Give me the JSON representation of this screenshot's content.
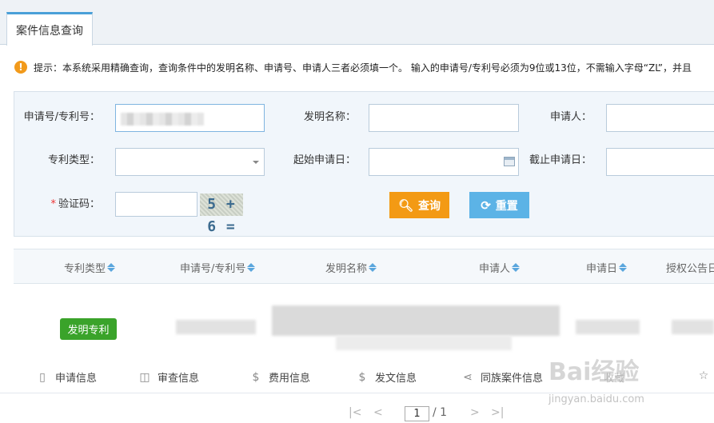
{
  "tab": {
    "label": "案件信息查询"
  },
  "tip": {
    "text": "提示：本系统采用精确查询，查询条件中的发明名称、申请号、申请人三者必须填一个。 输入的申请号/专利号必须为9位或13位，不需输入字母“ZL”，并且"
  },
  "form": {
    "app_no_label": "申请号/专利号：",
    "invention_name_label": "发明名称：",
    "applicant_label": "申请人：",
    "patent_type_label": "专利类型：",
    "start_date_label": "起始申请日：",
    "end_date_label": "截止申请日：",
    "captcha_required": "*",
    "captcha_label": "验证码：",
    "captcha_text": "5 + 6 =",
    "query_button": "查询",
    "reset_button": "重置"
  },
  "table": {
    "columns": [
      "专利类型",
      "申请号/专利号",
      "发明名称",
      "申请人",
      "申请日",
      "授权公告日"
    ],
    "row": {
      "patent_type": "发明专利"
    }
  },
  "actions": [
    "申请信息",
    "审查信息",
    "费用信息",
    "发文信息",
    "同族案件信息",
    "收藏"
  ],
  "pager": {
    "first": "|<",
    "prev": "<",
    "current": "1",
    "total": "/ 1",
    "next": ">",
    "last": ">|"
  },
  "watermark": {
    "brand": "Bai经验",
    "url": "jingyan.baidu.com"
  }
}
